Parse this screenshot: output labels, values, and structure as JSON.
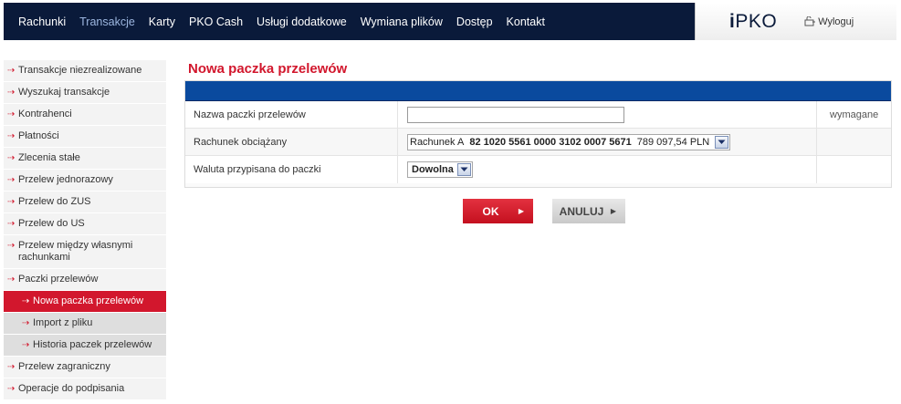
{
  "topnav": {
    "items": [
      "Rachunki",
      "Transakcje",
      "Karty",
      "PKO Cash",
      "Usługi dodatkowe",
      "Wymiana plików",
      "Dostęp",
      "Kontakt"
    ],
    "active_index": 1
  },
  "brand": {
    "logo_i": "i",
    "logo_text": "PKO",
    "logout_label": "Wyloguj"
  },
  "sidebar": {
    "items": [
      {
        "label": "Transakcje niezrealizowane",
        "level": 0
      },
      {
        "label": "Wyszukaj transakcje",
        "level": 0
      },
      {
        "label": "Kontrahenci",
        "level": 0
      },
      {
        "label": "Płatności",
        "level": 0
      },
      {
        "label": "Zlecenia stałe",
        "level": 0
      },
      {
        "label": "Przelew jednorazowy",
        "level": 0
      },
      {
        "label": "Przelew do ZUS",
        "level": 0
      },
      {
        "label": "Przelew do US",
        "level": 0
      },
      {
        "label": "Przelew między własnymi rachunkami",
        "level": 0
      },
      {
        "label": "Paczki przelewów",
        "level": 0
      },
      {
        "label": "Nowa paczka przelewów",
        "level": 1,
        "active": true
      },
      {
        "label": "Import z pliku",
        "level": 1
      },
      {
        "label": "Historia paczek przelewów",
        "level": 1
      },
      {
        "label": "Przelew zagraniczny",
        "level": 0
      },
      {
        "label": "Operacje do podpisania",
        "level": 0
      }
    ]
  },
  "main": {
    "title": "Nowa paczka przelewów",
    "form": {
      "package_name_label": "Nazwa paczki przelewów",
      "package_name_value": "",
      "required_note": "wymagane",
      "account_label": "Rachunek obciążany",
      "account_name": "Rachunek A",
      "account_number": "82 1020 5561 0000 3102 0007 5671",
      "account_balance": "789 097,54 PLN",
      "currency_label": "Waluta przypisana do paczki",
      "currency_value": "Dowolna"
    },
    "buttons": {
      "ok": "OK",
      "cancel": "ANULUJ"
    }
  },
  "colors": {
    "accent_red": "#d2172d",
    "navy": "#0a1a3a",
    "form_header_blue": "#0a4a9e"
  }
}
